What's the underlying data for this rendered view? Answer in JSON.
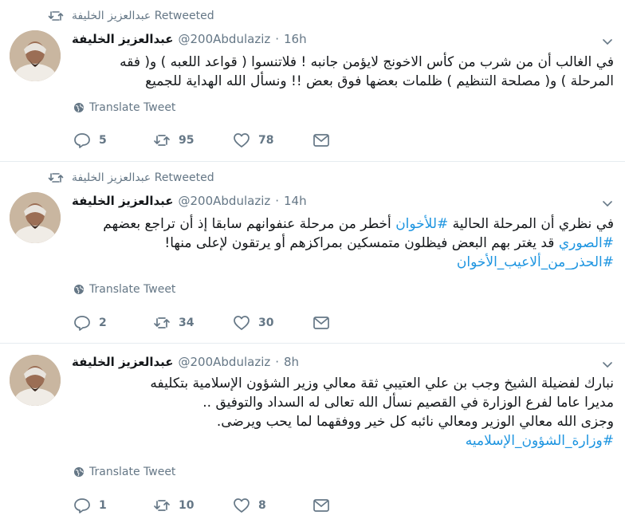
{
  "tweets": [
    {
      "retweeted_by": "عبدالعزيز الخليفة Retweeted",
      "display_name": "عبدالعزيز الخليفة",
      "handle": "@200Abdulaziz",
      "time": "16h",
      "lines": [
        {
          "text": "في الغالب أن من شرب من كأس الاخونج لايؤمن جانبه ! فلاتنسوا ( قواعد اللعبه ) و( فقه"
        },
        {
          "text": "المرحلة ) و( مصلحة التنظيم ) ظلمات بعضها فوق بعض !! ونسأل الله الهداية للجميع"
        }
      ],
      "translate": "Translate Tweet",
      "replies": "5",
      "retweets": "95",
      "likes": "78"
    },
    {
      "retweeted_by": "عبدالعزيز الخليفة Retweeted",
      "display_name": "عبدالعزيز الخليفة",
      "handle": "@200Abdulaziz",
      "time": "14h",
      "line1_pre": "في نظري أن المرحلة الحالية ",
      "line1_tag": "#للأخوان",
      "line1_post": " أخطر من مرحلة عنفوانهم سابقا إذ أن تراجع بعضهم",
      "line2_tag": "#الصوري",
      "line2_post": " قد يغتر بهم البعض فيظلون متمسكين بمراكزهم أو يرتقون لإعلى منها!",
      "line3_tag": "#الحذر_من_ألاعيب_الأخوان",
      "translate": "Translate Tweet",
      "replies": "2",
      "retweets": "34",
      "likes": "30"
    },
    {
      "display_name": "عبدالعزيز الخليفة",
      "handle": "@200Abdulaziz",
      "time": "8h",
      "line1": "نبارك لفضيلة الشيخ وجب بن علي العتيبي ثقة معالي وزير الشؤون الإسلامية بتكليفه",
      "line2": "مديرا عاما لفرع الوزارة في القصيم نسأل الله تعالى له السداد والتوفيق ..",
      "line3": "وجزى الله معالي الوزير ومعالي نائبه كل خير ووفقهما لما يحب ويرضى.",
      "line4_tag": "#وزارة_الشؤون_الإسلاميه",
      "translate": "Translate Tweet",
      "replies": "1",
      "retweets": "10",
      "likes": "8"
    }
  ],
  "colors": {
    "hashtag": "#1c94e0",
    "muted": "#657786",
    "divider": "#e6ecf0"
  },
  "icons": [
    "retweet-icon",
    "caret-down-icon",
    "globe-icon",
    "reply-icon",
    "like-icon",
    "message-icon",
    "avatar"
  ],
  "separator": "·"
}
